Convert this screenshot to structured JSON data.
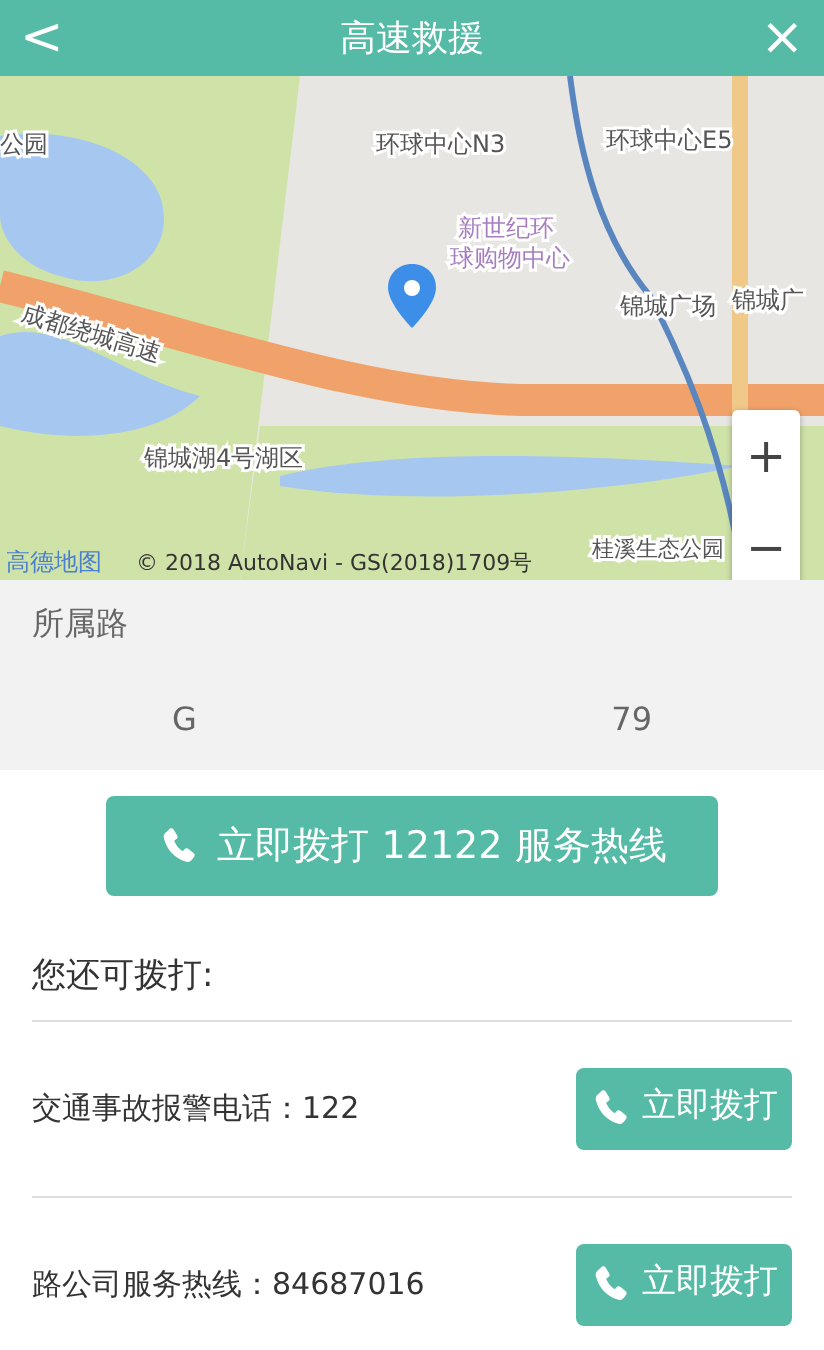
{
  "header": {
    "back": "<",
    "title": "高速救援",
    "close": "×"
  },
  "map": {
    "labels": [
      "公园",
      "环球中心N3",
      "环球中心E5",
      "新世纪环",
      "球购物中心",
      "锦城广场",
      "锦城广",
      "成都绕城高速",
      "锦城湖4号湖区",
      "桂溪生态公园"
    ],
    "zoom_in": "+",
    "zoom_out": "−",
    "logo": "高德地图",
    "attribution": "© 2018 AutoNavi - GS(2018)1709号"
  },
  "road": {
    "line_1": "所属路",
    "line_2_start": "G",
    "line_2_end": "79"
  },
  "hotline_button": "立即拨打 12122 服务热线",
  "more_label": "您还可拨打:",
  "contacts": [
    {
      "label": "交通事故报警电话：122",
      "button": "立即拨打"
    },
    {
      "label": "路公司服务热线：84687016",
      "button": "立即拨打"
    }
  ]
}
